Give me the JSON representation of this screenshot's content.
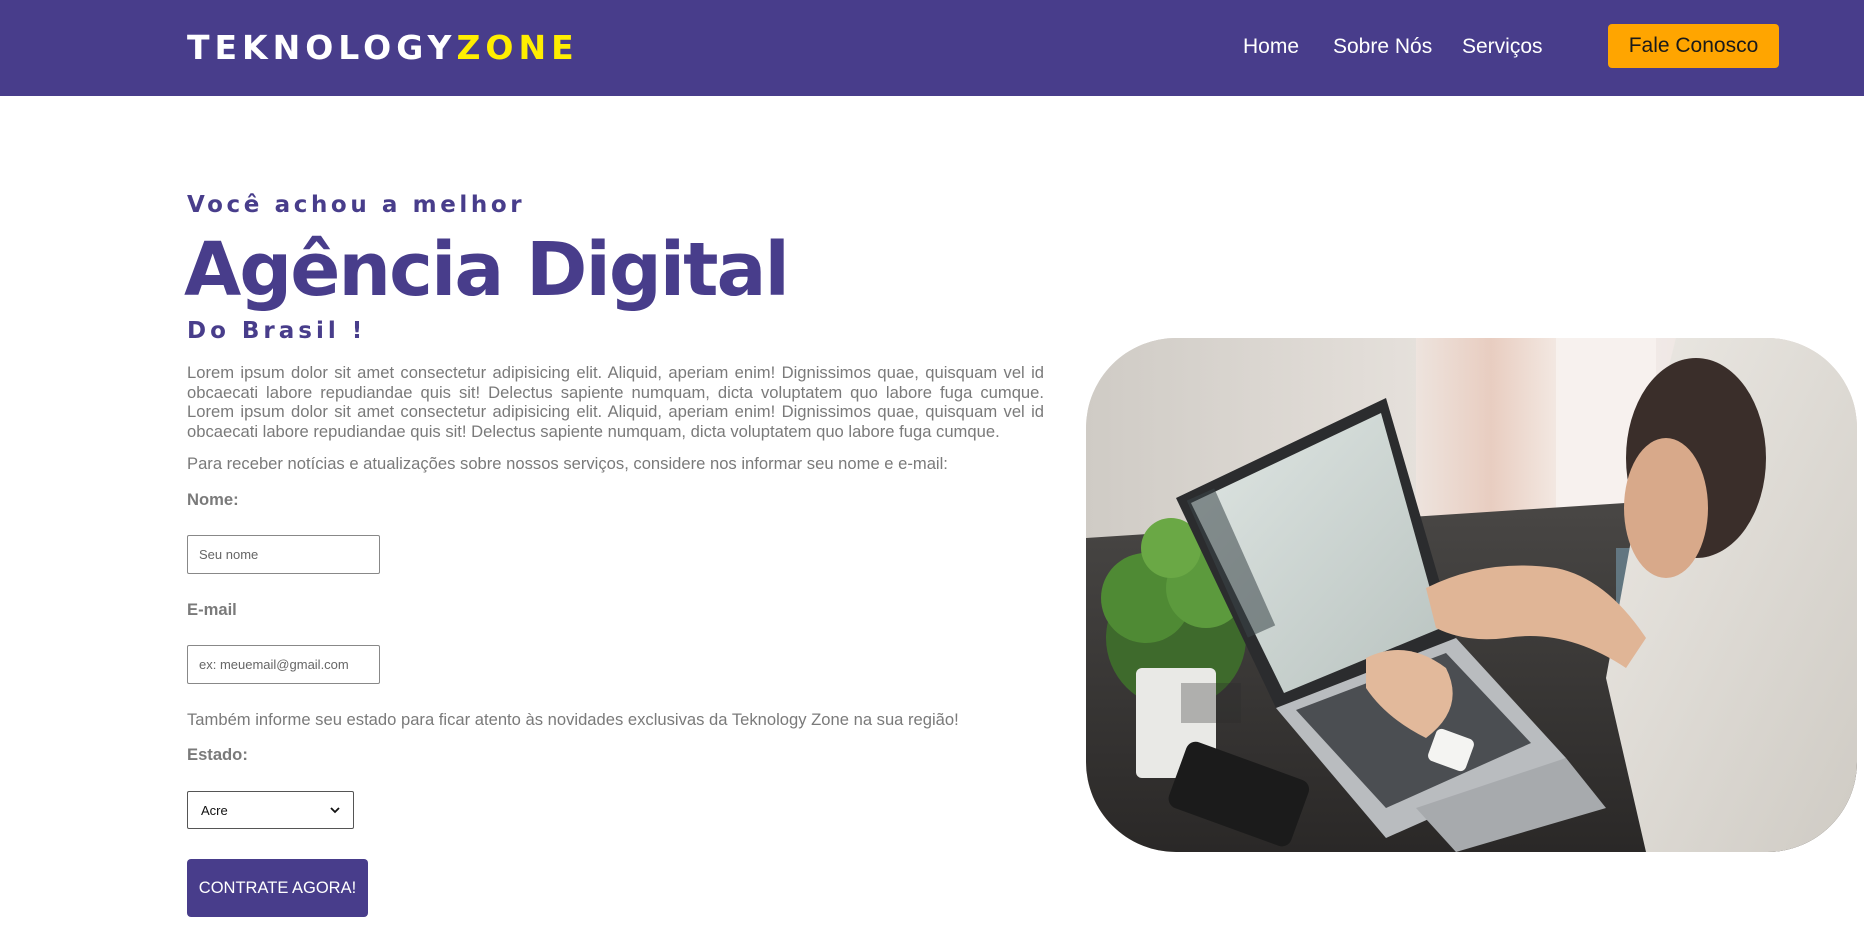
{
  "header": {
    "logo_main": "TEKNOLOGY",
    "logo_accent": "ZONE",
    "nav": [
      {
        "label": "Home"
      },
      {
        "label": "Sobre Nós"
      },
      {
        "label": "Serviços"
      }
    ],
    "cta_label": "Fale Conosco"
  },
  "hero": {
    "eyebrow": "Você achou a melhor",
    "headline": "Agência Digital",
    "subline": "Do Brasil !",
    "paragraph": "Lorem ipsum dolor sit amet consectetur adipisicing elit. Aliquid, aperiam enim! Dignissimos quae, quisquam vel id obcaecati labore repudiandae quis sit! Delectus sapiente numquam, dicta voluptatem quo labore fuga cumque. Lorem ipsum dolor sit amet consectetur adipisicing elit. Aliquid, aperiam enim! Dignissimos quae, quisquam vel id obcaecati labore repudiandae quis sit! Delectus sapiente numquam, dicta voluptatem quo labore fuga cumque."
  },
  "form": {
    "intro": "Para receber notícias e atualizações sobre nossos serviços, considere nos informar seu nome e e-mail:",
    "name_label": "Nome:",
    "name_placeholder": "Seu nome",
    "name_value": "",
    "email_label": "E-mail",
    "email_placeholder": "ex: meuemail@gmail.com",
    "email_value": "",
    "region_text": "Também informe seu estado para ficar atento às novidades exclusivas da Teknology Zone na sua região!",
    "state_label": "Estado:",
    "state_selected": "Acre",
    "submit_label": "CONTRATE AGORA!"
  },
  "colors": {
    "primary": "#483d8b",
    "accent_yellow": "#ffee00",
    "cta_orange": "#ffa500",
    "body_text": "#7a7a7a"
  },
  "icons": {
    "select_arrow": "chevron-down-icon"
  }
}
